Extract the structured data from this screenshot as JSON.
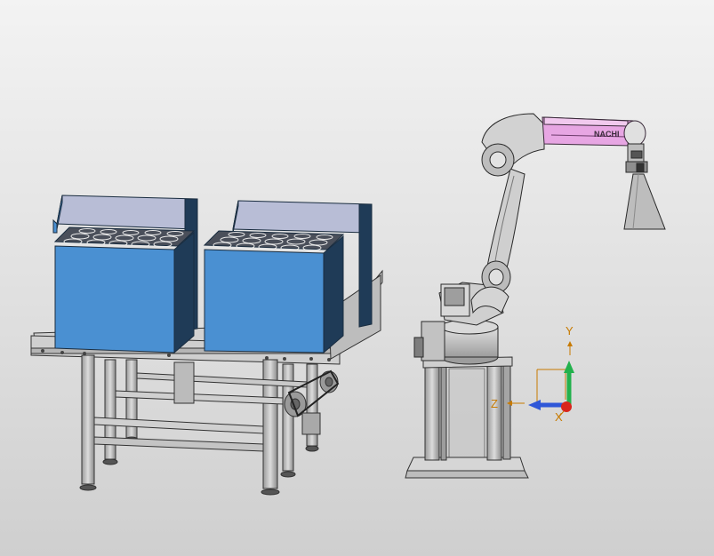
{
  "viewport": {
    "background_top": "#f3f3f3",
    "background_bottom": "#cfcfcf"
  },
  "colors": {
    "bin_blue": "#4a90d2",
    "bin_dark": "#1f3b57",
    "bin_inner": "#b8bdd6",
    "frame_gray": "#c8c8c8",
    "robot_gray": "#cdcdcd",
    "robot_arm_highlight": "#e7a6e3",
    "axis_y": "#22b14c",
    "axis_z": "#2f57d8",
    "axis_x": "#d9251c",
    "axis_label": "#c77a00"
  },
  "robot": {
    "brand_label": "NACHI"
  },
  "triad": {
    "y_label": "Y",
    "z_label": "Z",
    "x_label": "X"
  }
}
